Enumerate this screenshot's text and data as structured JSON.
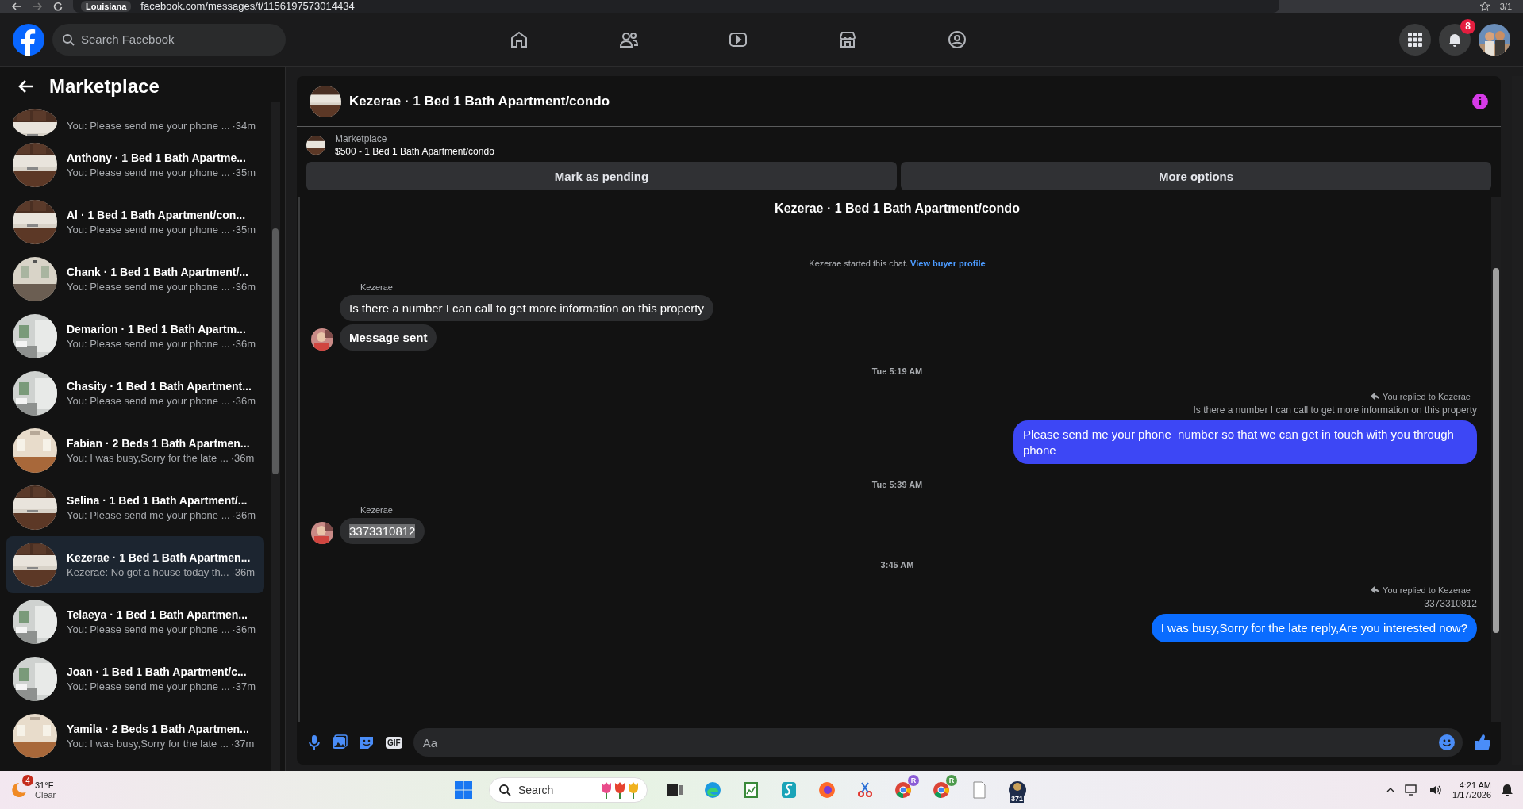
{
  "browser": {
    "location_chip": "Louisiana",
    "url": "facebook.com/messages/t/1156197573014434",
    "page_counter": "3/1"
  },
  "nav": {
    "search": {
      "placeholder": "Search Facebook"
    },
    "tabs": [
      {
        "kind": "home"
      },
      {
        "kind": "friends"
      },
      {
        "kind": "video"
      },
      {
        "kind": "marketplace"
      },
      {
        "kind": "groups"
      }
    ],
    "notification_badge": "8"
  },
  "sidebar": {
    "title": "Marketplace",
    "conversations": [
      {
        "preview": "You: Please send me your phone ...",
        "time": "·34m",
        "selected": false
      },
      {
        "name": "Anthony · 1 Bed 1 Bath Apartme...",
        "preview": "You: Please send me your phone ...",
        "time": "·35m",
        "selected": false
      },
      {
        "name": "Al · 1 Bed 1 Bath Apartment/con...",
        "preview": "You: Please send me your phone ...",
        "time": "·35m",
        "selected": false
      },
      {
        "name": "Chank · 1 Bed 1 Bath Apartment/...",
        "preview": "You: Please send me your phone ...",
        "time": "·36m",
        "selected": false
      },
      {
        "name": "Demarion · 1 Bed 1 Bath Apartm...",
        "preview": "You: Please send me your phone ...",
        "time": "·36m",
        "selected": false
      },
      {
        "name": "Chasity · 1 Bed 1 Bath Apartment...",
        "preview": "You: Please send me your phone ...",
        "time": "·36m",
        "selected": false
      },
      {
        "name": "Fabian · 2 Beds 1 Bath Apartmen...",
        "preview": "You: I was busy,Sorry for the late ...",
        "time": "·36m",
        "selected": false
      },
      {
        "name": "Selina · 1 Bed 1 Bath Apartment/...",
        "preview": "You: Please send me your phone ...",
        "time": "·36m",
        "selected": false
      },
      {
        "name": "Kezerae · 1 Bed 1 Bath Apartmen...",
        "preview": "Kezerae: No got a house today th...",
        "time": "·36m",
        "selected": true
      },
      {
        "name": "Telaeya · 1 Bed 1 Bath Apartmen...",
        "preview": "You: Please send me your phone ...",
        "time": "·36m",
        "selected": false
      },
      {
        "name": "Joan · 1 Bed 1 Bath Apartment/c...",
        "preview": "You: Please send me your phone ...",
        "time": "·37m",
        "selected": false
      },
      {
        "name": "Yamila · 2 Beds 1 Bath Apartmen...",
        "preview": "You: I was busy,Sorry for the late ...",
        "time": "·37m",
        "selected": false
      }
    ]
  },
  "chat": {
    "title": "Kezerae · 1 Bed 1 Bath Apartment/condo",
    "listing": {
      "label": "Marketplace",
      "title": "$500 - 1 Bed 1 Bath Apartment/condo"
    },
    "buttons": [
      "Mark as pending",
      "More options"
    ],
    "thread_title": "Kezerae · 1 Bed 1 Bath Apartment/condo",
    "messages": [
      {
        "kind": "system",
        "text": "Kezerae started this chat.",
        "link": "View buyer profile"
      },
      {
        "kind": "incoming",
        "sender": "Kezerae",
        "bubbles": [
          {
            "text": "Is there a number I can call to get more information on this property",
            "bold": false,
            "highlighted": false
          },
          {
            "text": "Message sent",
            "bold": true,
            "highlighted": false
          }
        ]
      },
      {
        "kind": "time",
        "text": "Tue 5:19 AM"
      },
      {
        "kind": "outgoing",
        "reply_note": "You replied to Kezerae",
        "quoted": "Is there a number I can call to get more information on this property",
        "text": "Please send me your phone  number so that we can get in touch with you through phone",
        "color": "#3d47f5"
      },
      {
        "kind": "time",
        "text": "Tue 5:39 AM"
      },
      {
        "kind": "incoming",
        "sender": "Kezerae",
        "bubbles": [
          {
            "text": "3373310812",
            "bold": false,
            "highlighted": true
          }
        ]
      },
      {
        "kind": "time",
        "text": "3:45 AM"
      },
      {
        "kind": "outgoing",
        "reply_note": "You replied to Kezerae",
        "quoted": "3373310812",
        "text": "I was busy,Sorry for the late reply,Are you interested now?",
        "color": "#0a6cff"
      }
    ],
    "composer": {
      "placeholder": "Aa",
      "gif_label": "GIF"
    }
  },
  "taskbar": {
    "weather": {
      "badge": "4",
      "temperature": "31°F",
      "condition": "Clear"
    },
    "search": {
      "placeholder": "Search"
    },
    "apps": [
      {
        "kind": "task-view"
      },
      {
        "kind": "edge"
      },
      {
        "kind": "chart"
      },
      {
        "kind": "s-app"
      },
      {
        "kind": "firefox"
      },
      {
        "kind": "snip"
      },
      {
        "kind": "chrome",
        "badge": "R",
        "color": "#8b5cd6"
      },
      {
        "kind": "chrome",
        "badge": "R",
        "color": "#4c9a4c"
      },
      {
        "kind": "file"
      },
      {
        "kind": "badge-app",
        "label": "371"
      }
    ],
    "clock": {
      "time": "4:21 AM",
      "date": "1/17/2026"
    }
  }
}
